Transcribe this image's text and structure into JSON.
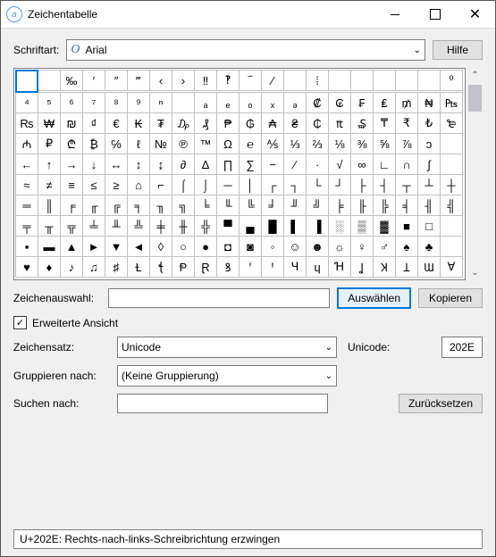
{
  "window": {
    "title": "Zeichentabelle"
  },
  "labels": {
    "schriftart": "Schriftart:",
    "hilfe": "Hilfe",
    "zeichenauswahl": "Zeichenauswahl:",
    "auswaehlen": "Auswählen",
    "kopieren": "Kopieren",
    "erweitert": "Erweiterte Ansicht",
    "zeichensatz": "Zeichensatz:",
    "unicode_lbl": "Unicode:",
    "gruppieren": "Gruppieren nach:",
    "suchen": "Suchen nach:",
    "zuruecksetzen": "Zurücksetzen"
  },
  "font": {
    "selected": "Arial"
  },
  "charset": {
    "selected": "Unicode"
  },
  "grouping": {
    "selected": "(Keine Gruppierung)"
  },
  "unicode_value": "202E",
  "status": "U+202E: Rechts-nach-links-Schreibrichtung erzwingen",
  "grid": [
    [
      "",
      "",
      "‰",
      "′",
      "″",
      "‴",
      "‹",
      "›",
      "‼",
      "‽",
      "‾",
      "⁄",
      "",
      "⁞",
      "",
      "",
      "",
      "",
      "",
      "⁰"
    ],
    [
      "⁴",
      "⁵",
      "⁶",
      "⁷",
      "⁸",
      "⁹",
      "ⁿ",
      "",
      "ₐ",
      "ₑ",
      "ₒ",
      "ₓ",
      "ₔ",
      "₡",
      "₢",
      "₣",
      "₤",
      "₥",
      "₦",
      "₧"
    ],
    [
      "₨",
      "₩",
      "₪",
      "₫",
      "€",
      "₭",
      "₮",
      "₯",
      "₰",
      "₱",
      "₲",
      "₳",
      "₴",
      "₵",
      "₶",
      "₷",
      "₸",
      "₹",
      "₺",
      "₻"
    ],
    [
      "₼",
      "₽",
      "₾",
      "₿",
      "℅",
      "ℓ",
      "№",
      "℗",
      "™",
      "Ω",
      "℮",
      "⅍",
      "⅓",
      "⅔",
      "⅛",
      "⅜",
      "⅝",
      "⅞",
      "ↄ",
      ""
    ],
    [
      "←",
      "↑",
      "→",
      "↓",
      "↔",
      "↕",
      "↨",
      "∂",
      "∆",
      "∏",
      "∑",
      "−",
      "∕",
      "∙",
      "√",
      "∞",
      "∟",
      "∩",
      "∫",
      ""
    ],
    [
      "≈",
      "≠",
      "≡",
      "≤",
      "≥",
      "⌂",
      "⌐",
      "⌠",
      "⌡",
      "─",
      "│",
      "┌",
      "┐",
      "└",
      "┘",
      "├",
      "┤",
      "┬",
      "┴",
      "┼"
    ],
    [
      "═",
      "║",
      "╒",
      "╓",
      "╔",
      "╕",
      "╖",
      "╗",
      "╘",
      "╙",
      "╚",
      "╛",
      "╜",
      "╝",
      "╞",
      "╟",
      "╠",
      "╡",
      "╢",
      "╣"
    ],
    [
      "╤",
      "╥",
      "╦",
      "╧",
      "╨",
      "╩",
      "╪",
      "╫",
      "╬",
      "▀",
      "▄",
      "█",
      "▌",
      "▐",
      "░",
      "▒",
      "▓",
      "■",
      "□",
      ""
    ],
    [
      "▪",
      "▬",
      "▲",
      "►",
      "▼",
      "◄",
      "◊",
      "○",
      "●",
      "◘",
      "◙",
      "◦",
      "☺",
      "☻",
      "☼",
      "♀",
      "♂",
      "♠",
      "♣",
      ""
    ],
    [
      "♥",
      "♦",
      "♪",
      "♫",
      "♯",
      "Ɫ",
      "ꞎ",
      "Ᵽ",
      "Ɽ",
      "ꝸ",
      "ꞌ",
      "Ꞌ",
      "Ɥ",
      "ɥ",
      "Ɦ",
      "Ʝ",
      "Ʞ",
      "Ʇ",
      "Ɯ",
      "Ɐ"
    ]
  ],
  "selected_cell": {
    "row": 0,
    "col": 0
  }
}
